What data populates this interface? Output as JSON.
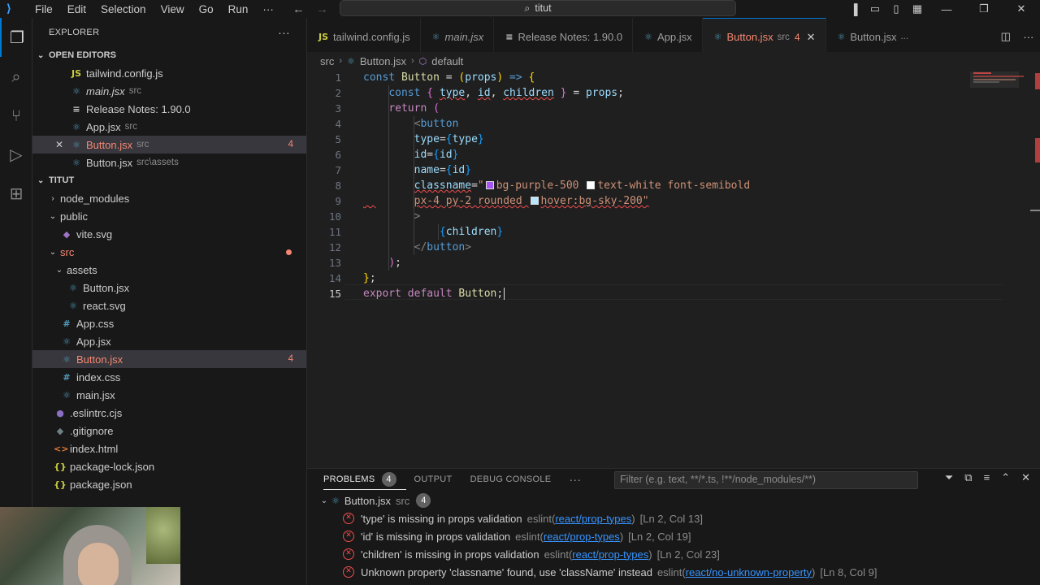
{
  "titlebar": {
    "menu": [
      "File",
      "Edit",
      "Selection",
      "View",
      "Go",
      "Run",
      "···"
    ],
    "search": "titut"
  },
  "explorer": {
    "title": "EXPLORER",
    "more": "···",
    "open_editors_label": "OPEN EDITORS",
    "open_editors": [
      {
        "icon": "JS",
        "name": "tailwind.config.js",
        "desc": "",
        "badge": "",
        "italic": false
      },
      {
        "icon": "⚛",
        "name": "main.jsx",
        "desc": "src",
        "badge": "",
        "italic": true
      },
      {
        "icon": "≡",
        "name": "Release Notes: 1.90.0",
        "desc": "",
        "badge": "",
        "italic": false
      },
      {
        "icon": "⚛",
        "name": "App.jsx",
        "desc": "src",
        "badge": "",
        "italic": false
      },
      {
        "icon": "⚛",
        "name": "Button.jsx",
        "desc": "src",
        "badge": "4",
        "italic": false
      },
      {
        "icon": "⚛",
        "name": "Button.jsx",
        "desc": "src\\assets",
        "badge": "",
        "italic": false
      }
    ],
    "project_label": "TITUT",
    "tree": [
      {
        "name": "node_modules",
        "type": "folder",
        "depth": 0,
        "open": false
      },
      {
        "name": "public",
        "type": "folder",
        "depth": 0,
        "open": true
      },
      {
        "name": "vite.svg",
        "type": "svg",
        "depth": 1
      },
      {
        "name": "src",
        "type": "folder",
        "depth": 0,
        "open": true,
        "error": true
      },
      {
        "name": "assets",
        "type": "folder",
        "depth": 1,
        "open": true
      },
      {
        "name": "Button.jsx",
        "type": "react",
        "depth": 2
      },
      {
        "name": "react.svg",
        "type": "react",
        "depth": 2
      },
      {
        "name": "App.css",
        "type": "css",
        "depth": 1
      },
      {
        "name": "App.jsx",
        "type": "react",
        "depth": 1
      },
      {
        "name": "Button.jsx",
        "type": "react",
        "depth": 1,
        "error": true,
        "badge": "4"
      },
      {
        "name": "index.css",
        "type": "css",
        "depth": 1
      },
      {
        "name": "main.jsx",
        "type": "react",
        "depth": 1
      },
      {
        "name": ".eslintrc.cjs",
        "type": "eslint",
        "depth": 0
      },
      {
        "name": ".gitignore",
        "type": "git",
        "depth": 0
      },
      {
        "name": "index.html",
        "type": "html",
        "depth": 0
      },
      {
        "name": "package-lock.json",
        "type": "json",
        "depth": 0
      },
      {
        "name": "package.json",
        "type": "json",
        "depth": 0
      }
    ]
  },
  "tabs": [
    {
      "icon": "JS",
      "label": "tailwind.config.js",
      "desc": "",
      "italic": false
    },
    {
      "icon": "⚛",
      "label": "main.jsx",
      "desc": "",
      "italic": true
    },
    {
      "icon": "≡",
      "label": "Release Notes: 1.90.0",
      "desc": "",
      "italic": false
    },
    {
      "icon": "⚛",
      "label": "App.jsx",
      "desc": "",
      "italic": false
    },
    {
      "icon": "⚛",
      "label": "Button.jsx",
      "desc": "src",
      "badge": "4",
      "active": true
    },
    {
      "icon": "⚛",
      "label": "Button.jsx",
      "desc": "...",
      "italic": false
    }
  ],
  "breadcrumb": [
    "src",
    "Button.jsx",
    "default"
  ],
  "editor": {
    "current_line": 15,
    "line_numbers": [
      "1",
      "2",
      "3",
      "4",
      "5",
      "6",
      "7",
      "8",
      "9",
      "10",
      "11",
      "12",
      "13",
      "14",
      "15"
    ]
  },
  "panel": {
    "tabs": [
      "PROBLEMS",
      "OUTPUT",
      "DEBUG CONSOLE",
      "···"
    ],
    "problems_count": "4",
    "filter_placeholder": "Filter (e.g. text, **/*.ts, !**/node_modules/**)",
    "file": "Button.jsx",
    "file_desc": "src",
    "file_count": "4",
    "problems": [
      {
        "msg": "'type' is missing in props validation",
        "src": "eslint",
        "rule": "react/prop-types",
        "loc": "[Ln 2, Col 13]"
      },
      {
        "msg": "'id' is missing in props validation",
        "src": "eslint",
        "rule": "react/prop-types",
        "loc": "[Ln 2, Col 19]"
      },
      {
        "msg": "'children' is missing in props validation",
        "src": "eslint",
        "rule": "react/prop-types",
        "loc": "[Ln 2, Col 23]"
      },
      {
        "msg": "Unknown property 'classname' found, use 'className' instead",
        "src": "eslint",
        "rule": "react/no-unknown-property",
        "loc": "[Ln 8, Col 9]"
      }
    ]
  },
  "colors": {
    "accent": "#0078d4",
    "error": "#f48771",
    "purple_swatch": "#a855f7",
    "white_swatch": "#ffffff",
    "sky_swatch": "#bae6fd"
  }
}
